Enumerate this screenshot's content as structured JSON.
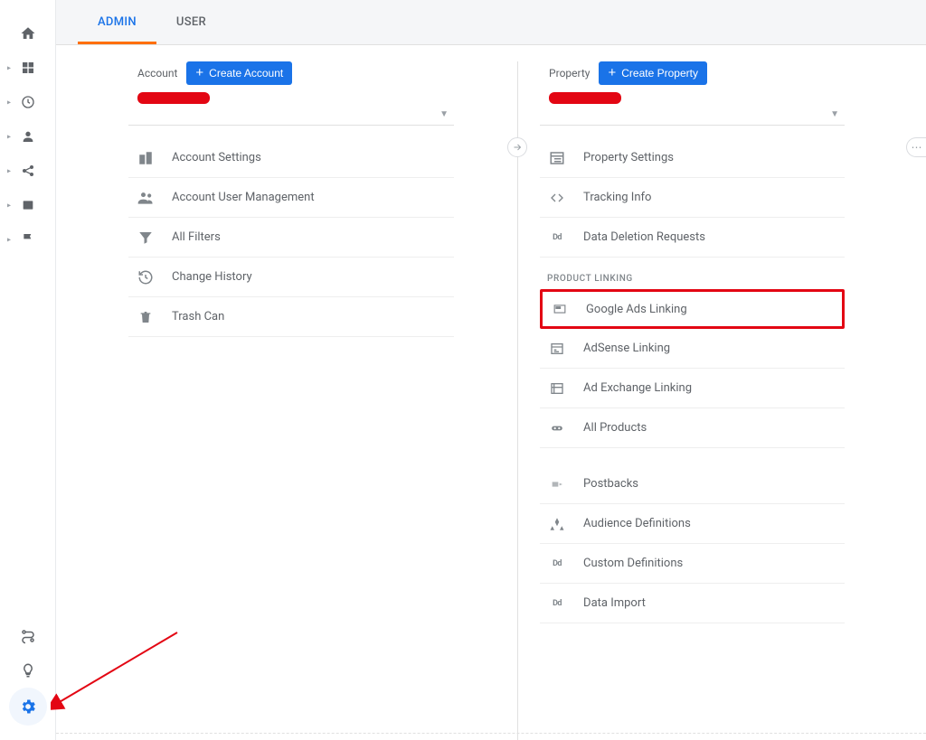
{
  "tabs": {
    "admin": "ADMIN",
    "user": "USER"
  },
  "account": {
    "label": "Account",
    "createBtn": "Create Account",
    "items": [
      "Account Settings",
      "Account User Management",
      "All Filters",
      "Change History",
      "Trash Can"
    ]
  },
  "property": {
    "label": "Property",
    "createBtn": "Create Property",
    "items_a": [
      "Property Settings",
      "Tracking Info",
      "Data Deletion Requests"
    ],
    "section_linking": "PRODUCT LINKING",
    "items_b": [
      "Google Ads Linking",
      "AdSense Linking",
      "Ad Exchange Linking",
      "All Products"
    ],
    "items_c": [
      "Postbacks",
      "Audience Definitions",
      "Custom Definitions",
      "Data Import"
    ]
  }
}
